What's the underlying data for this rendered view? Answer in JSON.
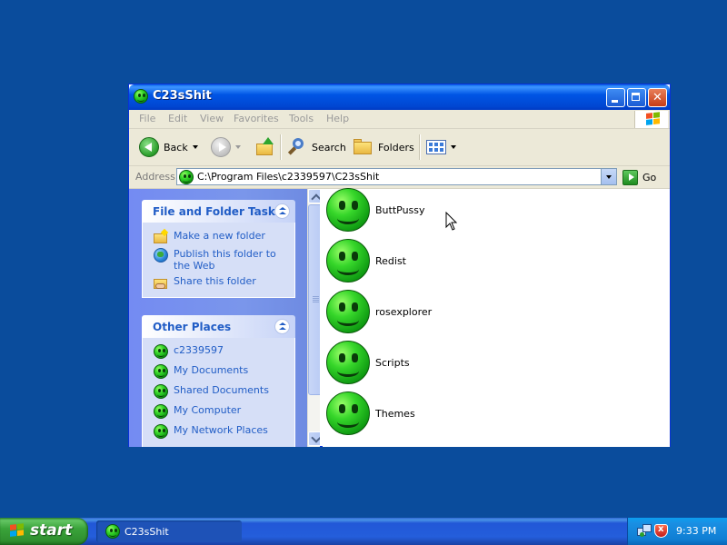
{
  "window": {
    "title": "C23sShit",
    "minimize_label": "",
    "maximize_label": "",
    "close_label": "✕"
  },
  "menubar": {
    "items": [
      "File",
      "Edit",
      "View",
      "Favorites",
      "Tools",
      "Help"
    ]
  },
  "toolbar": {
    "back_label": "Back",
    "search_label": "Search",
    "folders_label": "Folders"
  },
  "addressbar": {
    "label": "Address",
    "value": "C:\\Program Files\\c2339597\\C23sShit",
    "go_label": "Go"
  },
  "taskpane": {
    "file_tasks": {
      "title": "File and Folder Tasks",
      "items": [
        "Make a new folder",
        "Publish this folder to the Web",
        "Share this folder"
      ]
    },
    "other_places": {
      "title": "Other Places",
      "items": [
        "c2339597",
        "My Documents",
        "Shared Documents",
        "My Computer",
        "My Network Places"
      ]
    }
  },
  "content": {
    "items": [
      "ButtPussy",
      "Redist",
      "rosexplorer",
      "Scripts",
      "Themes"
    ]
  },
  "taskbar": {
    "start_label": "start",
    "task_label": "C23sShit",
    "clock": "9:33 PM"
  },
  "colors": {
    "desktop": "#0a4c9c",
    "titlebar": "#0055e5",
    "taskpane_link": "#215dc6",
    "start_green": "#3aa33a"
  }
}
